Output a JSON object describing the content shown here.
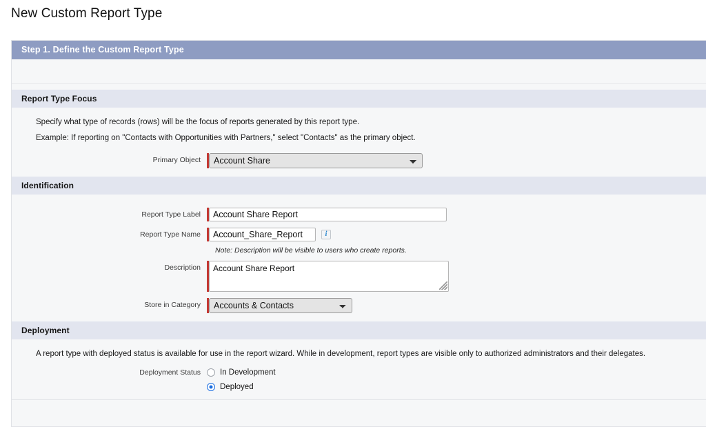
{
  "page": {
    "title": "New Custom Report Type"
  },
  "step": {
    "header": "Step 1. Define the Custom Report Type"
  },
  "sections": {
    "focus": {
      "header": "Report Type Focus",
      "help_line_1": "Specify what type of records (rows) will be the focus of reports generated by this report type.",
      "help_line_2": "Example: If reporting on \"Contacts with Opportunities with Partners,\" select \"Contacts\" as the primary object.",
      "primary_object_label": "Primary Object",
      "primary_object_value": "Account Share",
      "primary_object_options": [
        "Account Share"
      ]
    },
    "identification": {
      "header": "Identification",
      "report_type_label_label": "Report Type Label",
      "report_type_label_value": "Account Share Report",
      "report_type_name_label": "Report Type Name",
      "report_type_name_value": "Account_Share_Report",
      "info_icon_glyph": "i",
      "note": "Note: Description will be visible to users who create reports.",
      "description_label": "Description",
      "description_value": "Account Share Report",
      "store_in_category_label": "Store in Category",
      "store_in_category_value": "Accounts & Contacts",
      "store_in_category_options": [
        "Accounts & Contacts"
      ]
    },
    "deployment": {
      "header": "Deployment",
      "help_line_1": "A report type with deployed status is available for use in the report wizard. While in development, report types are visible only to authorized administrators and their delegates.",
      "status_label": "Deployment Status",
      "options": [
        {
          "label": "In Development",
          "selected": false
        },
        {
          "label": "Deployed",
          "selected": true
        }
      ]
    }
  },
  "colors": {
    "step_header_bg": "#8e9cc2",
    "section_header_bg": "#e2e5ef",
    "required_bar": "#c23934",
    "radio_selected": "#1b6ee0",
    "panel_bg": "#f6f7f8"
  }
}
